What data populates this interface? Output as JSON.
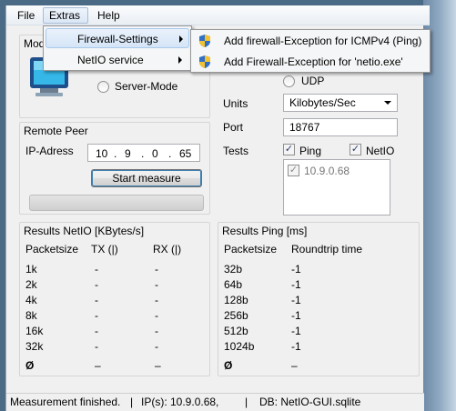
{
  "menubar": {
    "file": "File",
    "extras": "Extras",
    "help": "Help"
  },
  "extras_menu": {
    "items": [
      {
        "label": "Firewall-Settings"
      },
      {
        "label": "NetIO service"
      }
    ]
  },
  "firewall_submenu": {
    "items": [
      {
        "label": "Add firewall-Exception for ICMPv4 (Ping)"
      },
      {
        "label": "Add Firewall-Exception for 'netio.exe'"
      }
    ]
  },
  "mode": {
    "title": "Mode",
    "server_label": "Server-Mode"
  },
  "remote_peer": {
    "title": "Remote Peer",
    "ip_label": "IP-Adress",
    "ip_octets": [
      "10",
      "9",
      "0",
      "65"
    ],
    "start_button": "Start measure",
    "progress_fraction": 0
  },
  "settings": {
    "udp_label": "UDP",
    "units_label": "Units",
    "units_value": "Kilobytes/Sec",
    "port_label": "Port",
    "port_value": "18767",
    "tests_label": "Tests",
    "ping_label": "Ping",
    "netio_label": "NetIO",
    "ping_checked": true,
    "netio_checked": true,
    "hosts": [
      {
        "label": "10.9.0.68",
        "checked": true
      }
    ]
  },
  "results_netio": {
    "title": "Results NetIO [KBytes/s]",
    "headers": [
      "Packetsize",
      "TX (|)",
      "RX (|)"
    ],
    "rows": [
      [
        "1k",
        "-",
        "-"
      ],
      [
        "2k",
        "-",
        "-"
      ],
      [
        "4k",
        "-",
        "-"
      ],
      [
        "8k",
        "-",
        "-"
      ],
      [
        "16k",
        "-",
        "-"
      ],
      [
        "32k",
        "-",
        "-"
      ],
      [
        "Ø",
        "–",
        "–"
      ]
    ]
  },
  "results_ping": {
    "title": "Results Ping [ms]",
    "headers": [
      "Packetsize",
      "Roundtrip time"
    ],
    "rows": [
      [
        "32b",
        "-1"
      ],
      [
        "64b",
        "-1"
      ],
      [
        "128b",
        "-1"
      ],
      [
        "256b",
        "-1"
      ],
      [
        "512b",
        "-1"
      ],
      [
        "1024b",
        "-1"
      ],
      [
        "Ø",
        "–"
      ]
    ]
  },
  "status": {
    "message": "Measurement finished.",
    "sep1": "|",
    "ips": "IP(s): 10.9.0.68,",
    "sep2": "|",
    "db": "DB: NetIO-GUI.sqlite"
  },
  "colors": {
    "accent": "#3c7fb1",
    "desktop": "#4a6a86"
  },
  "icons": {
    "shield": "uac-shield-icon",
    "monitor": "monitor-icon"
  }
}
